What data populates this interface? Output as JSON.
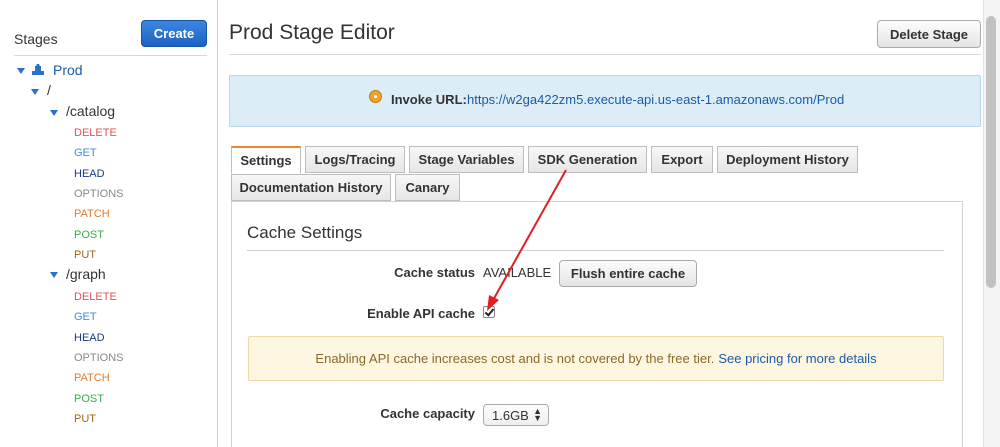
{
  "sidebar": {
    "heading": "Stages",
    "create_label": "Create",
    "stage_name": "Prod",
    "root_path": "/",
    "resources": [
      {
        "path": "/catalog",
        "methods": [
          "DELETE",
          "GET",
          "HEAD",
          "OPTIONS",
          "PATCH",
          "POST",
          "PUT"
        ]
      },
      {
        "path": "/graph",
        "methods": [
          "DELETE",
          "GET",
          "HEAD",
          "OPTIONS",
          "PATCH",
          "POST",
          "PUT"
        ]
      }
    ]
  },
  "header": {
    "title": "Prod Stage Editor",
    "delete_label": "Delete Stage"
  },
  "invoke": {
    "label": "Invoke URL:",
    "url": "https://w2ga422zm5.execute-api.us-east-1.amazonaws.com/Prod"
  },
  "tabs": [
    {
      "label": "Settings"
    },
    {
      "label": "Logs/Tracing"
    },
    {
      "label": "Stage Variables"
    },
    {
      "label": "SDK Generation"
    },
    {
      "label": "Export"
    },
    {
      "label": "Deployment History"
    },
    {
      "label": "Documentation History"
    },
    {
      "label": "Canary"
    }
  ],
  "cache": {
    "heading": "Cache Settings",
    "status_label": "Cache status",
    "status_value": "AVAILABLE",
    "flush_label": "Flush entire cache",
    "enable_label": "Enable API cache",
    "enabled": true,
    "warning_text": "Enabling API cache increases cost and is not covered by the free tier.",
    "warning_link": "See pricing for more details",
    "capacity_label": "Cache capacity",
    "capacity_value": "1.6GB"
  },
  "colors": {
    "accent_tab": "#e58b2b",
    "annotation_arrow": "#e02020",
    "create_button": "#2a73d0",
    "link": "#1c5ba8"
  }
}
